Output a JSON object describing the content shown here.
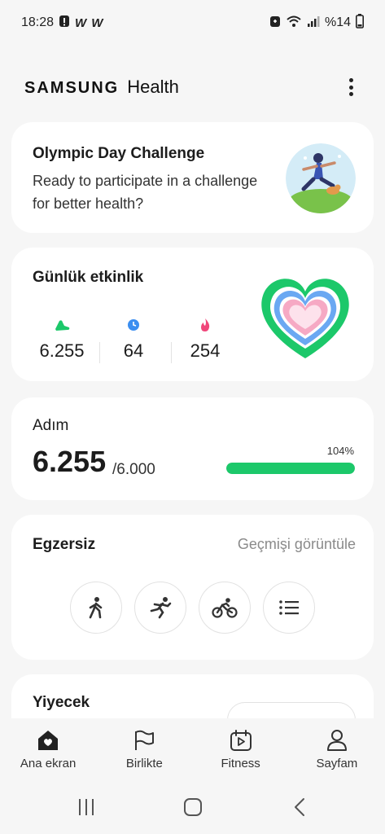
{
  "status_bar": {
    "time": "18:28",
    "notif_icons": [
      "alert-icon"
    ],
    "carrier_labels": [
      "W",
      "W"
    ],
    "battery_text": "%14",
    "right_icons": [
      "battery-saver-icon",
      "wifi-icon",
      "signal-icon"
    ]
  },
  "header": {
    "brand_samsung": "SAMSUNG",
    "brand_health": "Health",
    "menu_icon": "more-vert-icon"
  },
  "challenge": {
    "title": "Olympic Day Challenge",
    "description": "Ready to participate in a challenge for better health?"
  },
  "activity": {
    "title": "Günlük etkinlik",
    "steps": "6.255",
    "active_minutes": "64",
    "calories": "254",
    "colors": {
      "steps": "#1cc86a",
      "minutes": "#3b8ef0",
      "calories": "#f0467a"
    }
  },
  "steps": {
    "title": "Adım",
    "count": "6.255",
    "goal": "/6.000",
    "percent_label": "104%",
    "progress_fraction": 1.0
  },
  "exercise": {
    "title": "Egzersiz",
    "history_link": "Geçmişi görüntüle",
    "buttons": [
      "walking-icon",
      "running-icon",
      "cycling-icon",
      "list-icon"
    ]
  },
  "food": {
    "title": "Yiyecek"
  },
  "bottom_nav": {
    "items": [
      {
        "label": "Ana ekran",
        "icon": "home-icon",
        "active": true
      },
      {
        "label": "Birlikte",
        "icon": "flag-icon",
        "active": false
      },
      {
        "label": "Fitness",
        "icon": "play-calendar-icon",
        "active": false
      },
      {
        "label": "Sayfam",
        "icon": "person-icon",
        "active": false
      }
    ]
  },
  "system_nav": [
    "recents-icon",
    "home-icon",
    "back-icon"
  ]
}
